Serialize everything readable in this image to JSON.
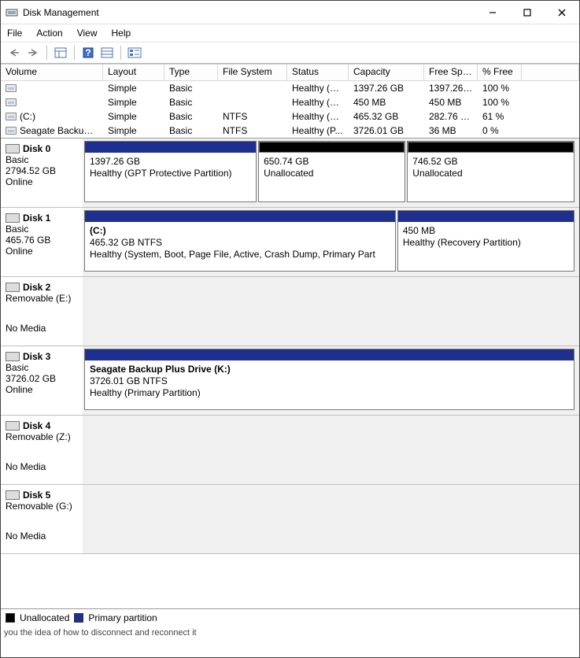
{
  "window": {
    "title": "Disk Management"
  },
  "menu": {
    "file": "File",
    "action": "Action",
    "view": "View",
    "help": "Help"
  },
  "cols": {
    "volume": "Volume",
    "layout": "Layout",
    "type": "Type",
    "fs": "File System",
    "status": "Status",
    "capacity": "Capacity",
    "free": "Free Spa...",
    "pct": "% Free"
  },
  "volumes": [
    {
      "name": "",
      "layout": "Simple",
      "type": "Basic",
      "fs": "",
      "status": "Healthy (G...",
      "cap": "1397.26 GB",
      "free": "1397.26 ...",
      "pct": "100 %"
    },
    {
      "name": "",
      "layout": "Simple",
      "type": "Basic",
      "fs": "",
      "status": "Healthy (R...",
      "cap": "450 MB",
      "free": "450 MB",
      "pct": "100 %"
    },
    {
      "name": "(C:)",
      "layout": "Simple",
      "type": "Basic",
      "fs": "NTFS",
      "status": "Healthy (S...",
      "cap": "465.32 GB",
      "free": "282.76 GB",
      "pct": "61 %"
    },
    {
      "name": "Seagate Backup Pl...",
      "layout": "Simple",
      "type": "Basic",
      "fs": "NTFS",
      "status": "Healthy (P...",
      "cap": "3726.01 GB",
      "free": "36 MB",
      "pct": "0 %"
    }
  ],
  "disks": [
    {
      "name": "Disk 0",
      "type": "Basic",
      "size": "2794.52 GB",
      "state": "Online",
      "parts": [
        {
          "top": "blue",
          "w": 34,
          "title": "",
          "size": "1397.26 GB",
          "status": "Healthy (GPT Protective Partition)"
        },
        {
          "top": "black",
          "w": 29,
          "title": "",
          "size": "650.74 GB",
          "status": "Unallocated"
        },
        {
          "top": "black",
          "w": 33,
          "title": "",
          "size": "746.52 GB",
          "status": "Unallocated"
        }
      ]
    },
    {
      "name": "Disk 1",
      "type": "Basic",
      "size": "465.76 GB",
      "state": "Online",
      "parts": [
        {
          "top": "blue",
          "w": 60,
          "title": "(C:)",
          "size": "465.32 GB NTFS",
          "status": "Healthy (System, Boot, Page File, Active, Crash Dump, Primary Part"
        },
        {
          "top": "blue",
          "w": 34,
          "title": "",
          "size": "450 MB",
          "status": "Healthy (Recovery Partition)"
        }
      ]
    },
    {
      "name": "Disk 2",
      "type": "Removable (E:)",
      "size": "",
      "state": "No Media",
      "parts": []
    },
    {
      "name": "Disk 3",
      "type": "Basic",
      "size": "3726.02 GB",
      "state": "Online",
      "parts": [
        {
          "top": "blue",
          "w": 100,
          "title": "Seagate Backup Plus Drive  (K:)",
          "size": "3726.01 GB NTFS",
          "status": "Healthy (Primary Partition)"
        }
      ]
    },
    {
      "name": "Disk 4",
      "type": "Removable (Z:)",
      "size": "",
      "state": "No Media",
      "parts": []
    },
    {
      "name": "Disk 5",
      "type": "Removable (G:)",
      "size": "",
      "state": "No Media",
      "parts": []
    }
  ],
  "legend": {
    "unalloc": "Unallocated",
    "primary": "Primary partition"
  },
  "crop": "you the idea of how to disconnect and reconnect it"
}
